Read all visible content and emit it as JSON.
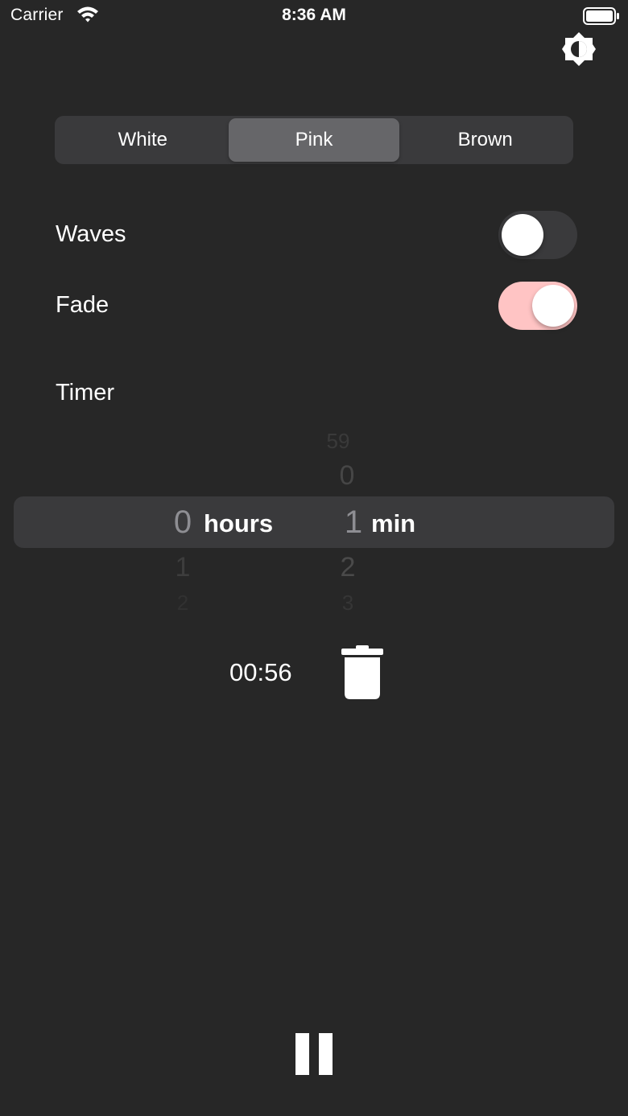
{
  "status_bar": {
    "carrier": "Carrier",
    "time": "8:36 AM",
    "wifi_icon": "wifi-icon",
    "battery_icon": "battery-full-icon"
  },
  "header": {
    "theme_icon": "brightness-icon"
  },
  "noise_selector": {
    "options": [
      "White",
      "Pink",
      "Brown"
    ],
    "selected": "Pink"
  },
  "settings": {
    "waves": {
      "label": "Waves",
      "on": false
    },
    "fade": {
      "label": "Fade",
      "on": true
    }
  },
  "timer": {
    "label": "Timer",
    "picker": {
      "hours": {
        "above": [
          "",
          ""
        ],
        "selected": "0",
        "below": [
          "1",
          "2"
        ],
        "unit": "hours"
      },
      "minutes": {
        "above": [
          "59",
          "0"
        ],
        "selected": "1",
        "below": [
          "2",
          "3"
        ],
        "unit": "min"
      }
    },
    "remaining": "00:56",
    "trash_icon": "trash-icon"
  },
  "playback": {
    "pause_icon": "pause-icon"
  },
  "colors": {
    "background": "#272727",
    "control_bg": "#3a3a3c",
    "segment_selected": "#666669",
    "toggle_on": "#ffc4c4"
  }
}
